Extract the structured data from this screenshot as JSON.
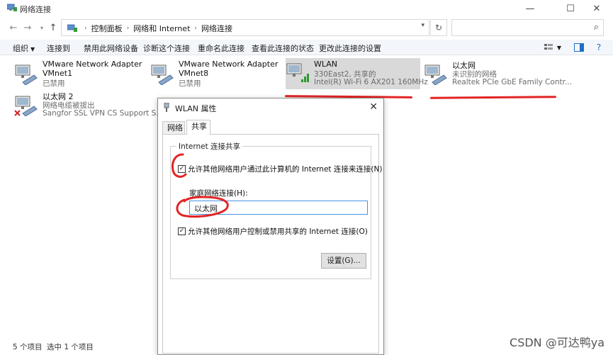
{
  "window": {
    "title": "网络连接",
    "minimize_glyph": "—",
    "maximize_glyph": "☐",
    "close_glyph": "✕"
  },
  "address": {
    "crumbs": [
      "控制面板",
      "网络和 Internet",
      "网络连接"
    ],
    "search_placeholder": ""
  },
  "commands": {
    "organize": "组织",
    "connect_to": "连接到",
    "disable_device": "禁用此网络设备",
    "diagnose": "诊断这个连接",
    "rename": "重命名此连接",
    "view_status": "查看此连接的状态",
    "change_settings": "更改此连接的设置"
  },
  "connections": [
    {
      "name": "VMware Network Adapter VMnet1",
      "line2": "已禁用",
      "line3": "",
      "icon": "network-adapter-icon"
    },
    {
      "name": "VMware Network Adapter VMnet8",
      "line2": "已禁用",
      "line3": "",
      "icon": "network-adapter-icon"
    },
    {
      "name": "WLAN",
      "line2": "330East2, 共享的",
      "line3": "Intel(R) Wi-Fi 6 AX201 160MHz",
      "icon": "wifi-adapter-icon"
    },
    {
      "name": "以太网",
      "line2": "未识别的网络",
      "line3": "Realtek PCIe GbE Family Contr...",
      "icon": "network-adapter-icon"
    },
    {
      "name": "以太网 2",
      "line2": "网络电缆被拔出",
      "line3": "Sangfor SSL VPN CS Support S...",
      "icon": "network-adapter-disconnected-icon"
    }
  ],
  "status": {
    "count": "5 个项目",
    "selected": "选中 1 个项目"
  },
  "watermark": "CSDN @可达鸭ya",
  "dialog": {
    "title": "WLAN 属性",
    "tabs": [
      "网络",
      "共享"
    ],
    "active_tab": "共享",
    "group_title": "Internet 连接共享",
    "allow_share_label": "允许其他网络用户通过此计算机的 Internet 连接来连接(N)",
    "allow_share_checked": true,
    "home_net_label": "家庭网络连接(H):",
    "home_net_value": "以太网",
    "allow_control_label": "允许其他网络用户控制或禁用共享的 Internet 连接(O)",
    "allow_control_checked": true,
    "settings_button": "设置(G)..."
  },
  "colors": {
    "annotation": "#e32424",
    "selection": "#cce8ff",
    "command_bar": "#f3f6fb"
  }
}
